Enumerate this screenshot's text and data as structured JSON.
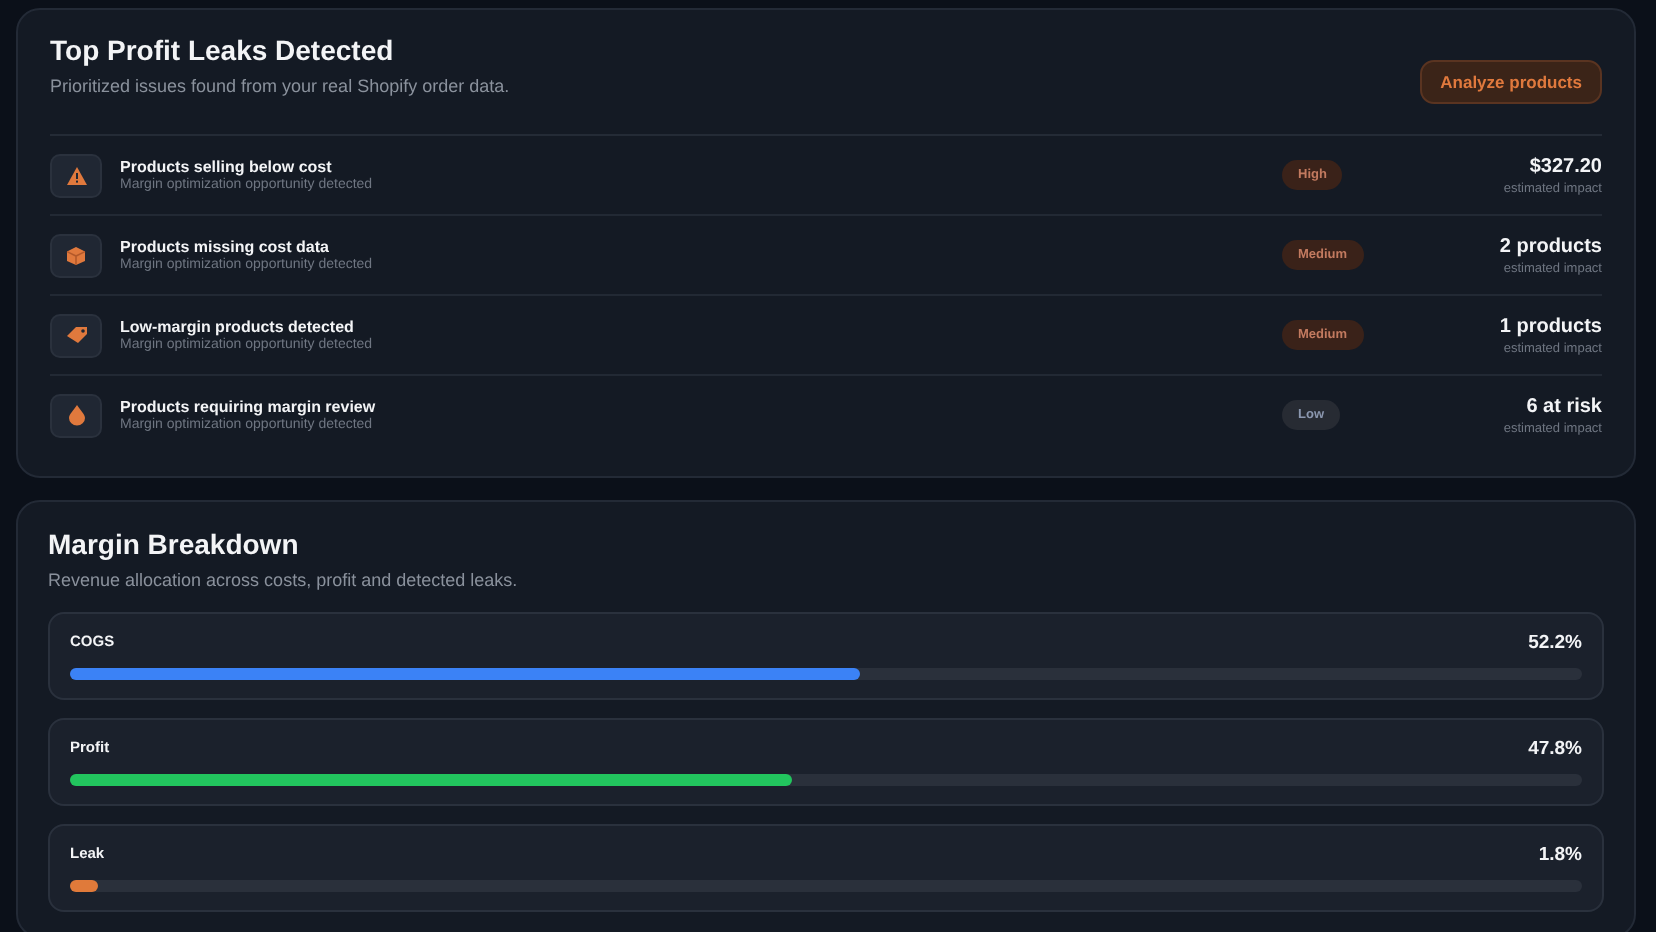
{
  "leaks": {
    "title": "Top Profit Leaks Detected",
    "subtitle": "Prioritized issues found from your real Shopify order data.",
    "action": "Analyze products",
    "rows": [
      {
        "kind": "warning",
        "title": "Products selling below cost",
        "description": "Margin optimization opportunity detected",
        "color": "#3a2219",
        "badge": "High",
        "value": "$327.20",
        "value_label": "estimated impact"
      },
      {
        "kind": "box",
        "title": "Products missing cost data",
        "description": "Margin optimization opportunity detected",
        "color": "#3a2219",
        "badge": "Medium",
        "value": "2 products",
        "value_label": "estimated impact"
      },
      {
        "kind": "tag",
        "title": "Low-margin products detected",
        "description": "Margin optimization opportunity detected",
        "color": "#3a2219",
        "badge": "Medium",
        "value": "1 products",
        "value_label": "estimated impact"
      },
      {
        "kind": "drop",
        "title": "Products requiring margin review",
        "description": "Margin optimization opportunity detected",
        "color": "#272b33",
        "badge": "Low",
        "value": "6 at risk",
        "value_label": "estimated impact"
      }
    ]
  },
  "breakdown": {
    "title": "Margin Breakdown",
    "subtitle": "Revenue allocation across costs, profit and detected leaks.",
    "items": [
      {
        "label": "COGS",
        "reading": "52.2%",
        "level": 0.522,
        "color": "#3b82f6"
      },
      {
        "label": "Profit",
        "reading": "47.8%",
        "level": 0.478,
        "color": "#22c55e"
      },
      {
        "label": "Leak",
        "reading": "1.8%",
        "level": 0.018,
        "color": "#e07a3a"
      }
    ]
  }
}
